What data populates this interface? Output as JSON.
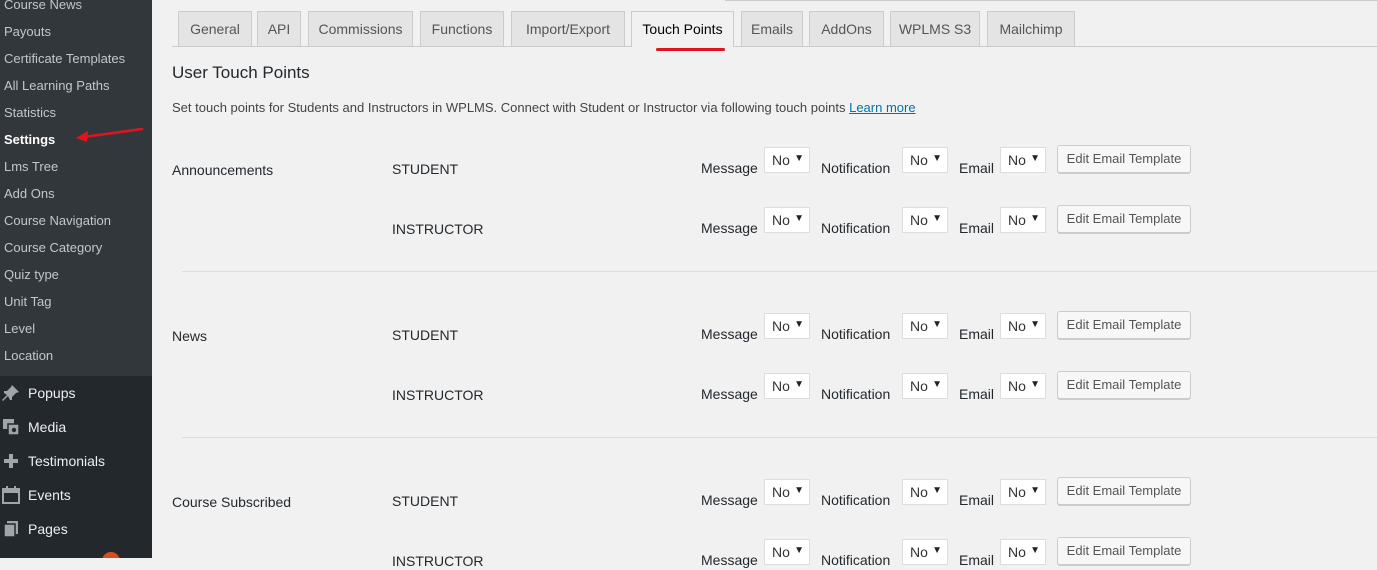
{
  "sidebar": {
    "submenu": [
      {
        "label": "Course News"
      },
      {
        "label": "Payouts"
      },
      {
        "label": "Certificate Templates"
      },
      {
        "label": "All Learning Paths"
      },
      {
        "label": "Statistics"
      },
      {
        "label": "Settings",
        "current": true
      },
      {
        "label": "Lms Tree"
      },
      {
        "label": "Add Ons"
      },
      {
        "label": "Course Navigation"
      },
      {
        "label": "Course Category"
      },
      {
        "label": "Quiz type"
      },
      {
        "label": "Unit Tag"
      },
      {
        "label": "Level"
      },
      {
        "label": "Location"
      }
    ],
    "menu": [
      {
        "label": "Popups",
        "icon": "pin-icon"
      },
      {
        "label": "Media",
        "icon": "media-icon"
      },
      {
        "label": "Testimonials",
        "icon": "plus-icon"
      },
      {
        "label": "Events",
        "icon": "calendar-icon"
      },
      {
        "label": "Pages",
        "icon": "pages-icon"
      }
    ]
  },
  "tabs": [
    {
      "label": "General"
    },
    {
      "label": "API"
    },
    {
      "label": "Commissions"
    },
    {
      "label": "Functions"
    },
    {
      "label": "Import/Export"
    },
    {
      "label": "Touch Points",
      "active": true
    },
    {
      "label": "Emails"
    },
    {
      "label": "AddOns"
    },
    {
      "label": "WPLMS S3"
    },
    {
      "label": "Mailchimp"
    }
  ],
  "page": {
    "title": "User Touch Points",
    "description": "Set touch points for Students and Instructors in WPLMS. Connect with Student or Instructor via following touch points",
    "learn_more": "Learn more"
  },
  "labels": {
    "message": "Message",
    "notification": "Notification",
    "email": "Email",
    "edit_button": "Edit Email Template"
  },
  "touch_points": [
    {
      "name": "Announcements",
      "rows": [
        {
          "role": "STUDENT",
          "message": "No",
          "notification": "No",
          "email": "No"
        },
        {
          "role": "INSTRUCTOR",
          "message": "No",
          "notification": "No",
          "email": "No"
        }
      ]
    },
    {
      "name": "News",
      "rows": [
        {
          "role": "STUDENT",
          "message": "No",
          "notification": "No",
          "email": "No"
        },
        {
          "role": "INSTRUCTOR",
          "message": "No",
          "notification": "No",
          "email": "No"
        }
      ]
    },
    {
      "name": "Course Subscribed",
      "rows": [
        {
          "role": "STUDENT",
          "message": "No",
          "notification": "No",
          "email": "No"
        },
        {
          "role": "INSTRUCTOR",
          "message": "No",
          "notification": "No",
          "email": "No"
        }
      ]
    }
  ],
  "colors": {
    "sidebar_bg": "#23282d",
    "submenu_bg": "#32373c",
    "link": "#0073aa",
    "annotation": "#e0141e"
  }
}
